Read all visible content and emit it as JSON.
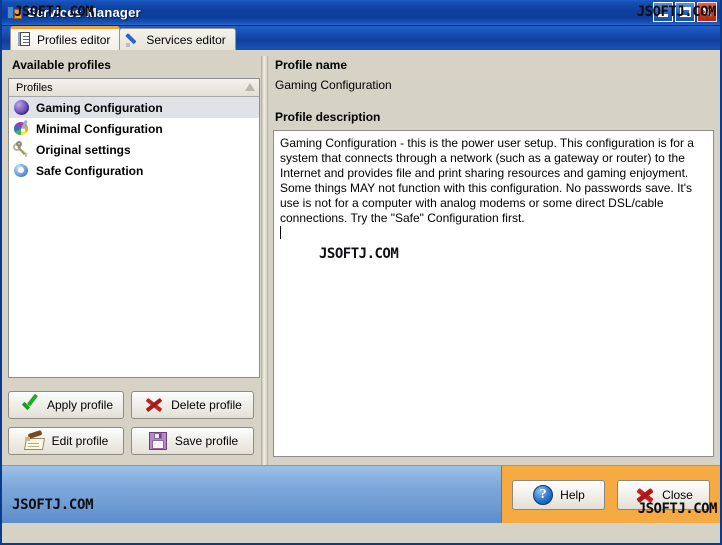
{
  "window": {
    "title": "Services Manager",
    "watermark": "JSOFTJ.COM",
    "icon": "app-icon",
    "buttons": {
      "minimize": "_",
      "maximize": "□",
      "close": "✕"
    }
  },
  "tabs": [
    {
      "label": "Profiles editor",
      "icon": "notebook-icon",
      "active": true
    },
    {
      "label": "Services editor",
      "icon": "pen-icon",
      "active": false
    }
  ],
  "left_panel": {
    "heading": "Available profiles",
    "list_header": "Profiles",
    "profiles": [
      {
        "label": "Gaming Configuration",
        "icon": "globe-icon",
        "selected": true
      },
      {
        "label": "Minimal Configuration",
        "icon": "palette-icon",
        "selected": false
      },
      {
        "label": "Original settings",
        "icon": "keys-icon",
        "selected": false
      },
      {
        "label": "Safe Configuration",
        "icon": "ring-icon",
        "selected": false
      }
    ],
    "buttons": [
      {
        "label": "Apply profile",
        "icon": "green-check-icon"
      },
      {
        "label": "Delete profile",
        "icon": "red-x-icon"
      },
      {
        "label": "Edit profile",
        "icon": "pencil-paper-icon"
      },
      {
        "label": "Save profile",
        "icon": "floppy-disk-icon"
      }
    ]
  },
  "right_panel": {
    "name_label": "Profile name",
    "name_value": "Gaming Configuration",
    "description_label": "Profile description",
    "description_text": "Gaming Configuration - this is the power user setup. This configuration is for a system that connects through a network (such as a gateway or router) to the Internet and provides file and print sharing resources and gaming enjoyment. Some things MAY not function with this configuration. No passwords save. It's use is not for a computer with analog modems or some direct DSL/cable connections. Try the \"Safe\" Configuration first.",
    "description_watermark": "JSOFTJ.COM"
  },
  "footer": {
    "watermark_left": "JSOFTJ.COM",
    "watermark_right": "JSOFTJ.COM",
    "buttons": [
      {
        "label": "Help",
        "icon": "help-question-icon"
      },
      {
        "label": "Close",
        "icon": "red-x-icon"
      }
    ]
  },
  "colors": {
    "titlebar": "#0e3f9e",
    "accent_orange": "#f5ab42",
    "tab_active_top": "#f0a23c",
    "panel_bg": "#d6d2c6",
    "footer_blue": "#7fa9dc"
  }
}
